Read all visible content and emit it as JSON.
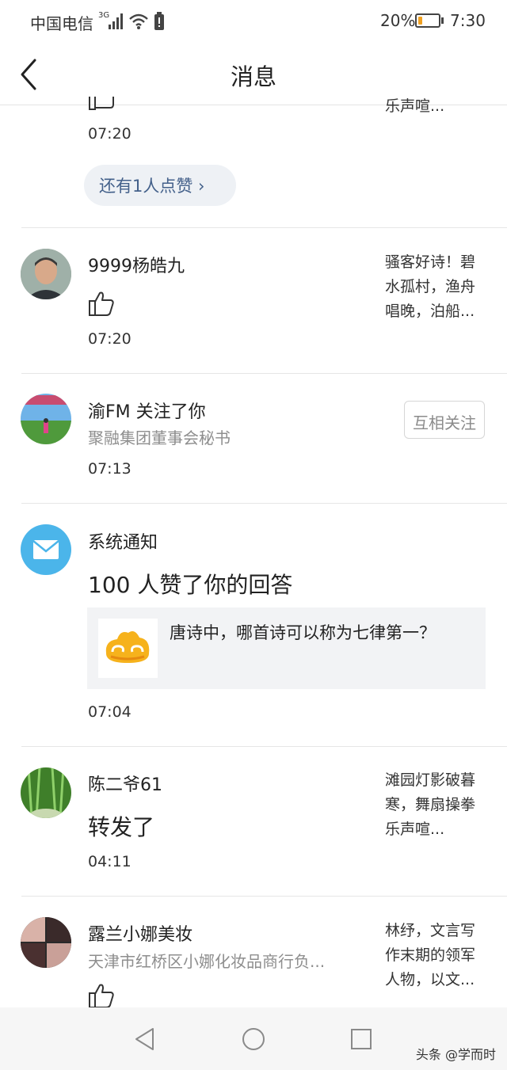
{
  "status_bar": {
    "carrier": "中国电信",
    "network": "3G",
    "battery": "20%",
    "time": "7:30",
    "battery_level": 0.2,
    "battery_color": "#f0a020"
  },
  "header": {
    "title": "消息"
  },
  "items": [
    {
      "time": "07:20",
      "snippet": "乐声喧...",
      "more_label": "还有1人点赞 ›"
    },
    {
      "name": "9999杨皓九",
      "time": "07:20",
      "snippet": "骚客好诗！碧水孤村，渔舟唱晚，泊船..."
    },
    {
      "name": "渝FM 关注了你",
      "subtitle": "聚融集团董事会秘书",
      "time": "07:13",
      "follow_label": "互相关注"
    },
    {
      "name": "系统通知",
      "headline": "100 人赞了你的回答",
      "question": "唐诗中，哪首诗可以称为七律第一？",
      "time": "07:04"
    },
    {
      "name": "陈二爷61",
      "action": "转发了",
      "time": "04:11",
      "snippet": "滩园灯影破暮寒，舞扇操拳乐声喧..."
    },
    {
      "name": "露兰小娜美妆",
      "subtitle": "天津市红桥区小娜化妆品商行负...",
      "snippet": "林纾，文言写作末期的领军人物，以文..."
    }
  ],
  "colors": {
    "accent_pill_bg": "#eef1f5",
    "accent_pill_text": "#43608a",
    "system_icon": "#4bb5ea"
  },
  "watermark": "头条 @学而时"
}
